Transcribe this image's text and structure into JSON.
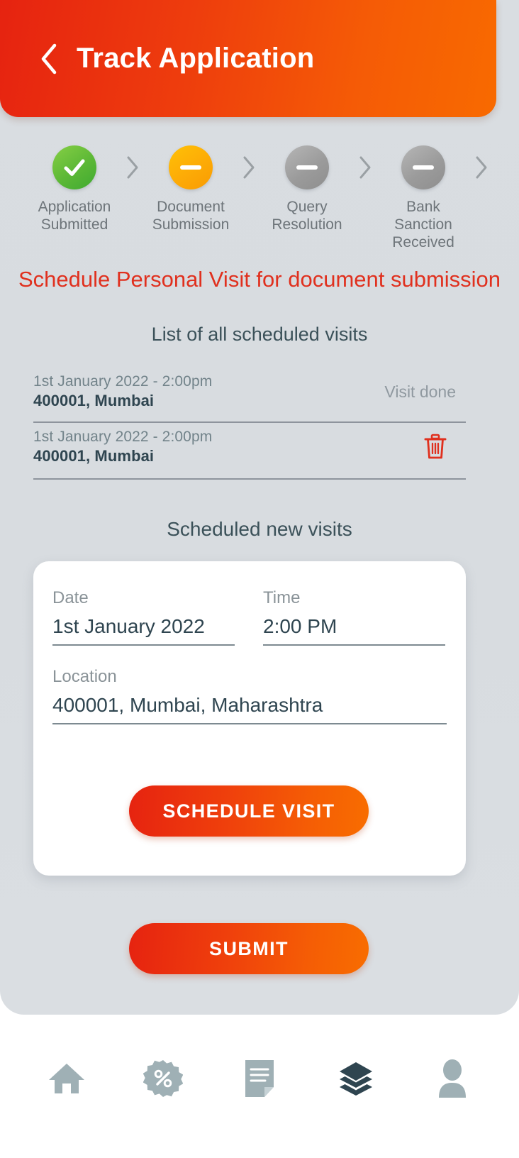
{
  "header": {
    "title": "Track Application",
    "back_icon": "chevron-left-icon",
    "gradient_from": "#e62310",
    "gradient_to": "#f86a00"
  },
  "stepper": {
    "steps": [
      {
        "label": "Application\nSubmitted",
        "state": "done",
        "icon": "check-icon",
        "color": "#5cb836"
      },
      {
        "label": "Document\nSubmission",
        "state": "active",
        "icon": "dash-icon",
        "color": "#fdab06"
      },
      {
        "label": "Query\nResolution",
        "state": "idle",
        "icon": "dash-icon",
        "color": "#9b9b9b"
      },
      {
        "label": "Bank Sanction\nReceived",
        "state": "idle",
        "icon": "dash-icon",
        "color": "#9b9b9b"
      }
    ],
    "separator_icon": "chevron-right-icon"
  },
  "main": {
    "title": "Schedule Personal Visit for document submission",
    "title_color": "#e0301e",
    "subtitle": "List of all scheduled visits",
    "section_heading": "Scheduled new visits",
    "visits": [
      {
        "when": "1st January 2022 - 2:00pm",
        "where": "400001, Mumbai",
        "status": "Visit done",
        "action": "status"
      },
      {
        "when": "1st January 2022 - 2:00pm",
        "where": "400001, Mumbai",
        "status": "",
        "action": "delete",
        "delete_icon": "trash-icon",
        "delete_color": "#e0301e"
      }
    ]
  },
  "form": {
    "date": {
      "label": "Date",
      "value": "1st January 2022"
    },
    "time": {
      "label": "Time",
      "value": "2:00 PM"
    },
    "location": {
      "label": "Location",
      "value": "400001, Mumbai, Maharashtra"
    },
    "schedule_button": "SCHEDULE VISIT"
  },
  "submit_button": "SUBMIT",
  "bottom_nav": {
    "items": [
      {
        "icon": "home-icon",
        "active": false,
        "color": "#9fb0b5"
      },
      {
        "icon": "percent-badge-icon",
        "active": false,
        "color": "#9fb0b5"
      },
      {
        "icon": "document-icon",
        "active": false,
        "color": "#9fb0b5"
      },
      {
        "icon": "layers-icon",
        "active": true,
        "color": "#2f4550"
      },
      {
        "icon": "person-icon",
        "active": false,
        "color": "#9fb0b5"
      }
    ]
  }
}
